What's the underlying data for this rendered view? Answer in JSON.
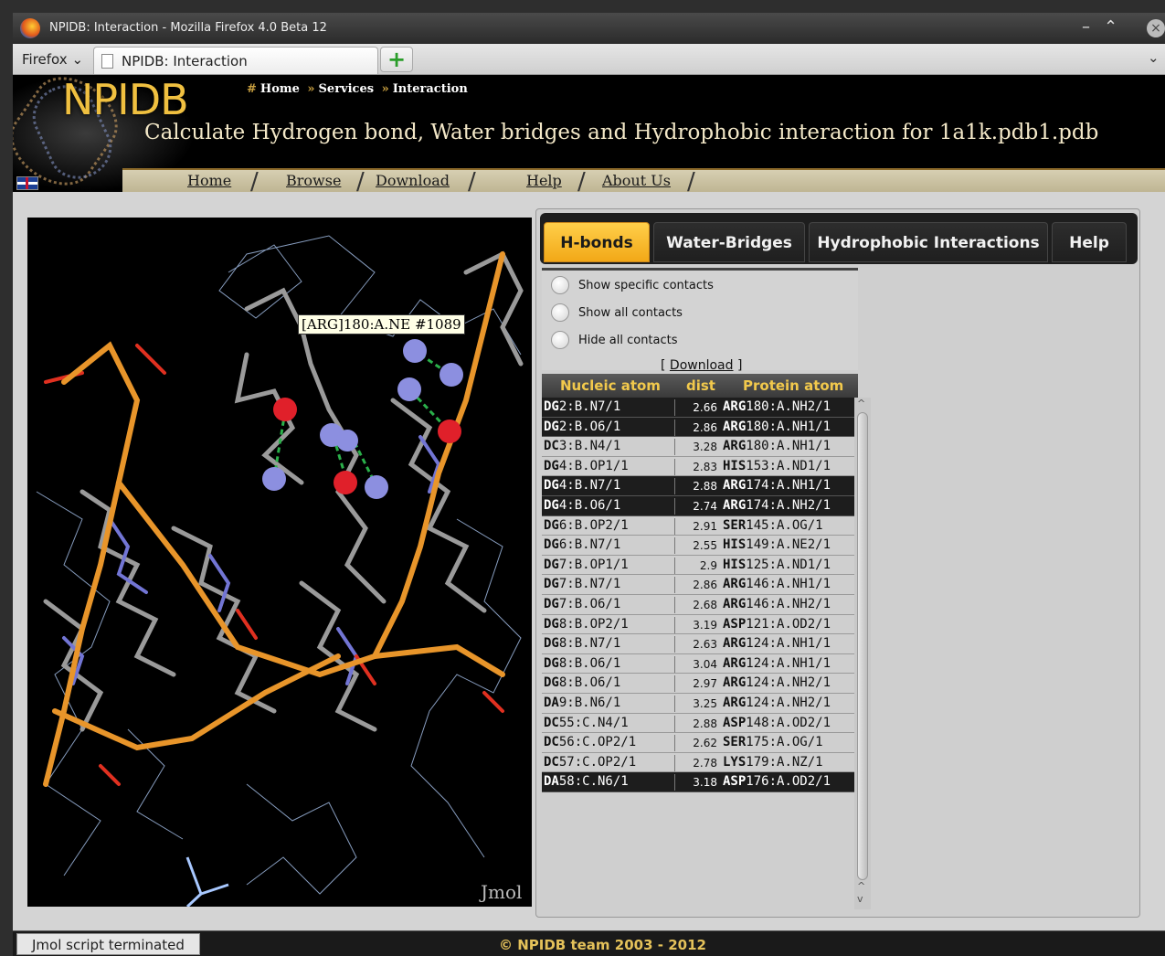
{
  "window": {
    "title": "NPIDB: Interaction - Mozilla Firefox 4.0 Beta 12",
    "minimize": "–",
    "maximize": "⌃",
    "close": "×"
  },
  "browser": {
    "menu_button": "Firefox",
    "tab_title": "NPIDB: Interaction",
    "new_tab": "+",
    "tab_list": "⌄"
  },
  "site": {
    "logo_text": "NPIDB",
    "breadcrumb": [
      "Home",
      "Services",
      "Interaction"
    ],
    "page_title": "Calculate Hydrogen bond, Water bridges and Hydrophobic interaction for 1a1k.pdb1.pdb",
    "nav": [
      "Home",
      "Browse",
      "Download",
      "Help",
      "About Us"
    ]
  },
  "viewer": {
    "hover_label": "[ARG]180:A.NE #1089",
    "watermark": "Jmol"
  },
  "panel": {
    "tabs": [
      "H-bonds",
      "Water-Bridges",
      "Hydrophobic Interactions",
      "Help"
    ],
    "active_tab": "H-bonds",
    "options": [
      "Show specific contacts",
      "Show all contacts",
      "Hide all contacts"
    ],
    "download": "Download",
    "columns": [
      "Nucleic atom",
      "dist",
      "Protein atom"
    ],
    "rows": [
      {
        "n_res": "DG",
        "n_rest": "2:B.N7/1",
        "dist": "2.66",
        "p_res": "ARG",
        "p_rest": "180:A.NH2/1",
        "dark": true
      },
      {
        "n_res": "DG",
        "n_rest": "2:B.O6/1",
        "dist": "2.86",
        "p_res": "ARG",
        "p_rest": "180:A.NH1/1",
        "dark": true
      },
      {
        "n_res": "DC",
        "n_rest": "3:B.N4/1",
        "dist": "3.28",
        "p_res": "ARG",
        "p_rest": "180:A.NH1/1",
        "dark": false
      },
      {
        "n_res": "DG",
        "n_rest": "4:B.OP1/1",
        "dist": "2.83",
        "p_res": "HIS",
        "p_rest": "153:A.ND1/1",
        "dark": false
      },
      {
        "n_res": "DG",
        "n_rest": "4:B.N7/1",
        "dist": "2.88",
        "p_res": "ARG",
        "p_rest": "174:A.NH1/1",
        "dark": true
      },
      {
        "n_res": "DG",
        "n_rest": "4:B.O6/1",
        "dist": "2.74",
        "p_res": "ARG",
        "p_rest": "174:A.NH2/1",
        "dark": true
      },
      {
        "n_res": "DG",
        "n_rest": "6:B.OP2/1",
        "dist": "2.91",
        "p_res": "SER",
        "p_rest": "145:A.OG/1",
        "dark": false
      },
      {
        "n_res": "DG",
        "n_rest": "6:B.N7/1",
        "dist": "2.55",
        "p_res": "HIS",
        "p_rest": "149:A.NE2/1",
        "dark": false
      },
      {
        "n_res": "DG",
        "n_rest": "7:B.OP1/1",
        "dist": "2.9",
        "p_res": "HIS",
        "p_rest": "125:A.ND1/1",
        "dark": false
      },
      {
        "n_res": "DG",
        "n_rest": "7:B.N7/1",
        "dist": "2.86",
        "p_res": "ARG",
        "p_rest": "146:A.NH1/1",
        "dark": false
      },
      {
        "n_res": "DG",
        "n_rest": "7:B.O6/1",
        "dist": "2.68",
        "p_res": "ARG",
        "p_rest": "146:A.NH2/1",
        "dark": false
      },
      {
        "n_res": "DG",
        "n_rest": "8:B.OP2/1",
        "dist": "3.19",
        "p_res": "ASP",
        "p_rest": "121:A.OD2/1",
        "dark": false
      },
      {
        "n_res": "DG",
        "n_rest": "8:B.N7/1",
        "dist": "2.63",
        "p_res": "ARG",
        "p_rest": "124:A.NH1/1",
        "dark": false
      },
      {
        "n_res": "DG",
        "n_rest": "8:B.O6/1",
        "dist": "3.04",
        "p_res": "ARG",
        "p_rest": "124:A.NH1/1",
        "dark": false
      },
      {
        "n_res": "DG",
        "n_rest": "8:B.O6/1",
        "dist": "2.97",
        "p_res": "ARG",
        "p_rest": "124:A.NH2/1",
        "dark": false
      },
      {
        "n_res": "DA",
        "n_rest": "9:B.N6/1",
        "dist": "3.25",
        "p_res": "ARG",
        "p_rest": "124:A.NH2/1",
        "dark": false
      },
      {
        "n_res": "DC",
        "n_rest": "55:C.N4/1",
        "dist": "2.88",
        "p_res": "ASP",
        "p_rest": "148:A.OD2/1",
        "dark": false
      },
      {
        "n_res": "DC",
        "n_rest": "56:C.OP2/1",
        "dist": "2.62",
        "p_res": "SER",
        "p_rest": "175:A.OG/1",
        "dark": false
      },
      {
        "n_res": "DC",
        "n_rest": "57:C.OP2/1",
        "dist": "2.78",
        "p_res": "LYS",
        "p_rest": "179:A.NZ/1",
        "dark": false
      },
      {
        "n_res": "DA",
        "n_rest": "58:C.N6/1",
        "dist": "3.18",
        "p_res": "ASP",
        "p_rest": "176:A.OD2/1",
        "dark": true
      }
    ]
  },
  "status": {
    "text": "Jmol script terminated",
    "footer": "© NPIDB team 2003 - 2012"
  },
  "colors": {
    "accent": "#f2a817",
    "header_bg": "#000000",
    "footer_text": "#e5c25a"
  }
}
